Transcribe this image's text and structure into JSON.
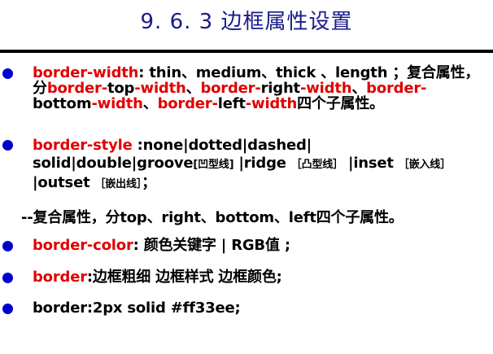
{
  "title": "9. 6. 3 边框属性设置",
  "items": [
    {
      "parts": [
        {
          "text": "border-width",
          "red": true
        },
        {
          "text": ": thin、medium、thick 、length ；复合属性，分",
          "red": false
        },
        {
          "text": "border-",
          "red": true
        },
        {
          "text": "top",
          "red": false
        },
        {
          "text": "-width",
          "red": true
        },
        {
          "text": "、",
          "red": false
        },
        {
          "text": "border-",
          "red": true
        },
        {
          "text": "right",
          "red": false
        },
        {
          "text": "-width",
          "red": true
        },
        {
          "text": "、",
          "red": false
        },
        {
          "text": "border-",
          "red": true
        },
        {
          "text": "bottom",
          "red": false
        },
        {
          "text": "-width",
          "red": true
        },
        {
          "text": "、",
          "red": false
        },
        {
          "text": "border-",
          "red": true
        },
        {
          "text": "left",
          "red": false
        },
        {
          "text": "-width",
          "red": true
        },
        {
          "text": "四个子属性。",
          "red": false
        }
      ]
    },
    {
      "parts": [
        {
          "text": "border-style",
          "red": true
        },
        {
          "text": " :none|dotted|dashed| solid|double|groove",
          "red": false
        },
        {
          "text": "[凹型线]",
          "red": false,
          "small": true
        },
        {
          "text": " |ridge ",
          "red": false
        },
        {
          "text": "［凸型线］",
          "red": false,
          "small": true
        },
        {
          "text": " |inset ",
          "red": false
        },
        {
          "text": "［嵌入线］",
          "red": false,
          "small": true
        },
        {
          "text": " |outset ",
          "red": false
        },
        {
          "text": "［嵌出线］",
          "red": false,
          "small": true
        },
        {
          "text": "；",
          "red": false
        }
      ]
    },
    {
      "parts": [
        {
          "text": "--复合属性，分top、right、bottom、left四个子属性。",
          "red": false
        }
      ]
    },
    {
      "parts": [
        {
          "text": "border-color",
          "red": true
        },
        {
          "text": ": 颜色关键字 | RGB值 ;",
          "red": false
        }
      ]
    },
    {
      "parts": [
        {
          "text": "border",
          "red": true
        },
        {
          "text": ":边框粗细  边框样式  边框颜色;",
          "red": false
        }
      ]
    },
    {
      "parts": [
        {
          "text": "border:2px solid #ff33ee;",
          "red": false
        }
      ]
    }
  ],
  "colors": {
    "title": "#1a1a8c",
    "bullet": "#0000cc",
    "highlight": "#e00000"
  },
  "icons": {
    "bullet": "bullet-dot-icon"
  }
}
